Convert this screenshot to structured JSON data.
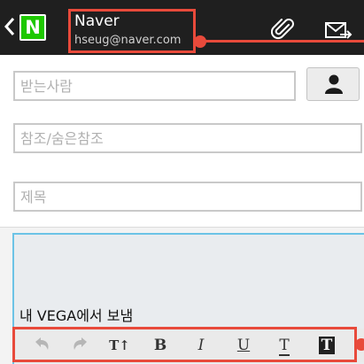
{
  "header": {
    "account_name": "Naver",
    "account_email": "hseug@naver.com",
    "logo_letter": "N",
    "icons": [
      "back-arrow-icon",
      "attachment-icon",
      "send-mail-icon"
    ]
  },
  "compose": {
    "to_placeholder": "받는사람",
    "cc_placeholder": "참조/숨은참조",
    "subject_placeholder": "제목",
    "signature": "내 VEGA에서 보냄"
  },
  "toolbar": {
    "text_size_label": "T↑",
    "bold_label": "B",
    "italic_label": "I",
    "underline_label": "U",
    "strike_label": "T",
    "highlight_label": "T"
  },
  "colors": {
    "header_bg": "#1f1f1f",
    "brand_green": "#1ec800",
    "callout_red": "#e84a3b",
    "focus_blue": "#6cc3e6"
  }
}
